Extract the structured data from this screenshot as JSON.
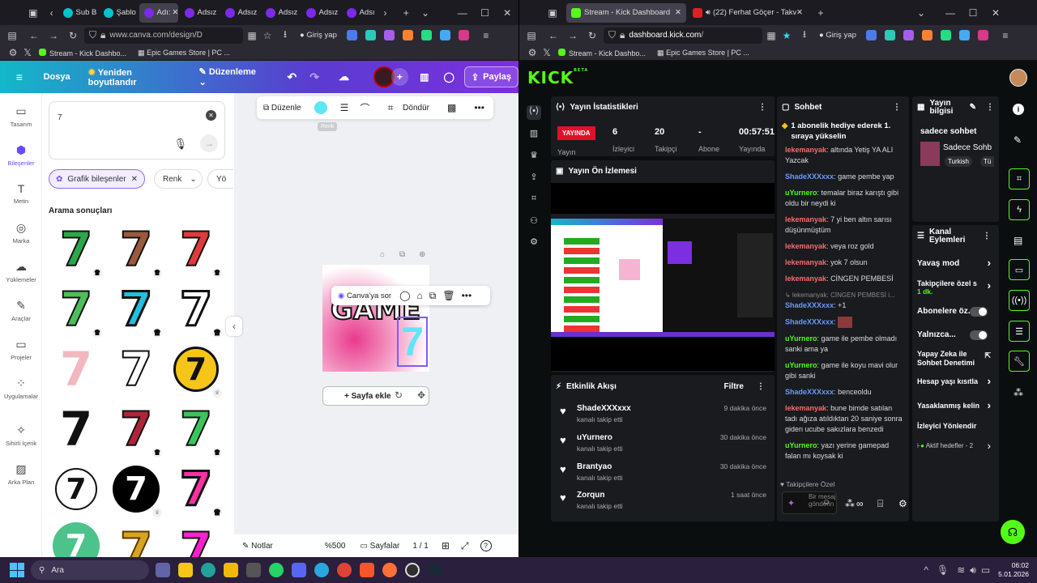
{
  "left_browser": {
    "tabs": [
      "Sub B",
      "Şablo",
      "Adı:",
      "Adsız",
      "Adsız",
      "Adsız",
      "Adsız",
      "Adsı"
    ],
    "url": "www.canva.com/design/D",
    "signin": "Giriş yap",
    "bookmarks": [
      "Stream - Kick Dashbo...",
      "Epic Games Store | PC ..."
    ]
  },
  "canva": {
    "menu_home": "Dosya",
    "resize": "Yeniden boyutlandır",
    "edit_mode": "Düzenleme",
    "share": "Paylaş",
    "rail": [
      "Tasarım",
      "Bileşenler",
      "Metin",
      "Marka",
      "Yüklemeler",
      "Araçlar",
      "Projeler",
      "Uygulamalar",
      "Sihirli İçerik",
      "Arka Plan"
    ],
    "search_value": "7",
    "filter_chip": "Grafik bileşenler",
    "color_filter": "Renk",
    "more_filter": "Yö",
    "results_title": "Arama sonuçları",
    "toolbar_edit": "Düzenle",
    "toolbar_color_tip": "Renk",
    "toolbar_rotate": "Döndür",
    "ask_canva": "Canva'ya sor",
    "add_page": "+ Sayfa ekle",
    "notes": "Notlar",
    "zoom": "%500",
    "pages": "Sayfalar",
    "page_count": "1 / 1",
    "canvas_text": "GAME"
  },
  "right_browser": {
    "tab1": "Stream - Kick Dashboard",
    "tab2": "(22) Ferhat Göçer - Takvim",
    "url_domain": "dashboard.kick.com",
    "url_rest": "/",
    "signin": "Giriş yap",
    "bookmarks": [
      "Stream - Kick Dashbo...",
      "Epic Games Store | PC ..."
    ]
  },
  "kick": {
    "logo": "KICK",
    "logo_beta": "BETA",
    "stats_title": "Yayın İstatistikleri",
    "live": "YAYINDA",
    "stats": [
      {
        "value": "6",
        "label": "İzleyici"
      },
      {
        "value": "20",
        "label": "Takipçi"
      },
      {
        "value": "-",
        "label": "Abone"
      },
      {
        "value": "00:57:51",
        "label": "Yayında"
      }
    ],
    "stats_label_first": "Yayın",
    "preview_title": "Yayın Ön İzlemesi",
    "activity_title": "Etkinlik Akışı",
    "activity_filter": "Filtre",
    "activity": [
      {
        "name": "ShadeXXXxxx",
        "sub": "kanalı takip etti",
        "time": "9 dakika önce"
      },
      {
        "name": "uYurnero",
        "sub": "kanalı takip etti",
        "time": "30 dakika önce"
      },
      {
        "name": "Brantyao",
        "sub": "kanalı takip etti",
        "time": "30 dakika önce"
      },
      {
        "name": "Zorqun",
        "sub": "kanalı takip etti",
        "time": "1 saat önce"
      }
    ],
    "chat_title": "Sohbet",
    "pinned": "1 abonelik hediye ederek 1. sıraya yükselin",
    "chat": [
      {
        "user": "lekemanyak",
        "text": "altında Yetiş YA ALI Yazcak",
        "c": "u1"
      },
      {
        "user": "ShadeXXXxxx",
        "text": "game pembe yap",
        "c": "u2"
      },
      {
        "user": "uYurnero",
        "text": "temalar biraz karıştı gibi oldu bir neydi ki",
        "c": "u3"
      },
      {
        "user": "lekemanyak",
        "text": "7 yi ben altın sarısı düşünmüştüm",
        "c": "u1"
      },
      {
        "user": "lekemanyak",
        "text": "veya roz gold",
        "c": "u1"
      },
      {
        "user": "lekemanyak",
        "text": "yok 7 olsun",
        "c": "u1"
      },
      {
        "user": "lekemanyak",
        "text": "CİNGEN PEMBESİ",
        "c": "u1"
      }
    ],
    "reply_line": "lekemanyak: CİNGEN PEMBESİ i...",
    "chat2": [
      {
        "user": "ShadeXXXxxx",
        "text": "+1",
        "c": "u2"
      },
      {
        "user": "ShadeXXXxxx",
        "text": "",
        "c": "u2"
      },
      {
        "user": "uYurnero",
        "text": "game ile pembe olmadı sanki ama ya",
        "c": "u3"
      },
      {
        "user": "uYurnero",
        "text": "game ile koyu mavi olur gibi sanki",
        "c": "u3"
      },
      {
        "user": "ShadeXXXxxx",
        "text": "benceoldu",
        "c": "u2"
      },
      {
        "user": "lekemanyak",
        "text": "bune bimde satılan tadı ağıza atıldıktan 20 saniye sonra giden ucube sakızlara benzedi",
        "c": "u1"
      },
      {
        "user": "uYurnero",
        "text": "yazı yerine gamepad falan mı koysak ki",
        "c": "u3"
      }
    ],
    "followers_only": "Takipçilere Özel",
    "chat_placeholder": "Bir mesaj gönderin",
    "info_title": "Yayın bilgisi",
    "stream_title": "sadece sohbet",
    "category": "Sadece Sohb",
    "tags": [
      "Turkish",
      "Tü"
    ],
    "actions_title": "Kanal Eylemleri",
    "actions": [
      {
        "label": "Yavaş mod"
      },
      {
        "label": "Takipçilere özel s",
        "sub": "1 dk."
      },
      {
        "label": "Abonelere öz..."
      },
      {
        "label": "Yalnızca..."
      },
      {
        "label": "Yapay Zeka ile Sohbet Denetimi"
      },
      {
        "label": "Hesap yaşı kısıtla"
      },
      {
        "label": "Yasaklanmış kelin"
      },
      {
        "label": "İzleyici Yönlendir"
      },
      {
        "label": "Aktif hedefler - 2"
      }
    ]
  },
  "taskbar": {
    "search": "Ara",
    "time": "06:02",
    "date": "5.01.2026"
  }
}
